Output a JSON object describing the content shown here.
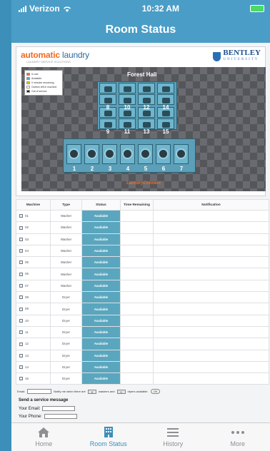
{
  "status_bar": {
    "carrier": "Verizon",
    "time": "10:32 AM"
  },
  "nav": {
    "title": "Room Status"
  },
  "panel": {
    "brand_part1": "automatic",
    "brand_part2": " laundry",
    "tagline": "LAUNDRY SERVICE SOLUTIONS",
    "uni_name": "BENTLEY",
    "uni_sub": "UNIVERSITY",
    "hall_name": "Forest Hall",
    "legend": [
      {
        "label": "In use",
        "color": "#f26a21"
      },
      {
        "label": "Available",
        "color": "#5aa6be"
      },
      {
        "label": "0 minutes remaining",
        "color": "#f5c400"
      },
      {
        "label": "Clothes left in machine",
        "color": "#ffffff"
      },
      {
        "label": "Out of service",
        "color": "#222222"
      }
    ],
    "dryer_numbers": [
      "8",
      "10",
      "12",
      "14",
      "9",
      "11",
      "13",
      "15"
    ],
    "washer_numbers": [
      "1",
      "2",
      "3",
      "4",
      "5",
      "6",
      "7"
    ],
    "footer": "LaundryConnect"
  },
  "table": {
    "headers": [
      "Machine",
      "Type",
      "Status",
      "Time Remaining",
      "Notification"
    ],
    "rows": [
      {
        "machine": "01",
        "type": "Washer",
        "status": "Available"
      },
      {
        "machine": "02",
        "type": "Washer",
        "status": "Available"
      },
      {
        "machine": "03",
        "type": "Washer",
        "status": "Available"
      },
      {
        "machine": "04",
        "type": "Washer",
        "status": "Available"
      },
      {
        "machine": "05",
        "type": "Washer",
        "status": "Available"
      },
      {
        "machine": "06",
        "type": "Washer",
        "status": "Available"
      },
      {
        "machine": "07",
        "type": "Washer",
        "status": "Available"
      },
      {
        "machine": "08",
        "type": "Dryer",
        "status": "Available"
      },
      {
        "machine": "09",
        "type": "Dryer",
        "status": "Available"
      },
      {
        "machine": "10",
        "type": "Dryer",
        "status": "Available"
      },
      {
        "machine": "11",
        "type": "Dryer",
        "status": "Available"
      },
      {
        "machine": "12",
        "type": "Dryer",
        "status": "Available"
      },
      {
        "machine": "13",
        "type": "Dryer",
        "status": "Available"
      },
      {
        "machine": "14",
        "type": "Dryer",
        "status": "Available"
      },
      {
        "machine": "15",
        "type": "Dryer",
        "status": "Available"
      }
    ]
  },
  "notify": {
    "email_label": "Email:",
    "text1": "Notify me when there are",
    "washers_value": "0",
    "text2": "washers and",
    "dryers_value": "0",
    "text3": "dryers available.",
    "ok_label": "OK"
  },
  "service": {
    "title": "Send a service message",
    "email_label": "Your Email:",
    "phone_label": "Your Phone:"
  },
  "tabs": [
    {
      "label": "Home",
      "icon": "home-icon"
    },
    {
      "label": "Room Status",
      "icon": "building-icon"
    },
    {
      "label": "History",
      "icon": "list-icon"
    },
    {
      "label": "More",
      "icon": "more-icon"
    }
  ],
  "colors": {
    "accent": "#3b8fb8",
    "available": "#5aa6be",
    "brand_orange": "#f26a21"
  }
}
